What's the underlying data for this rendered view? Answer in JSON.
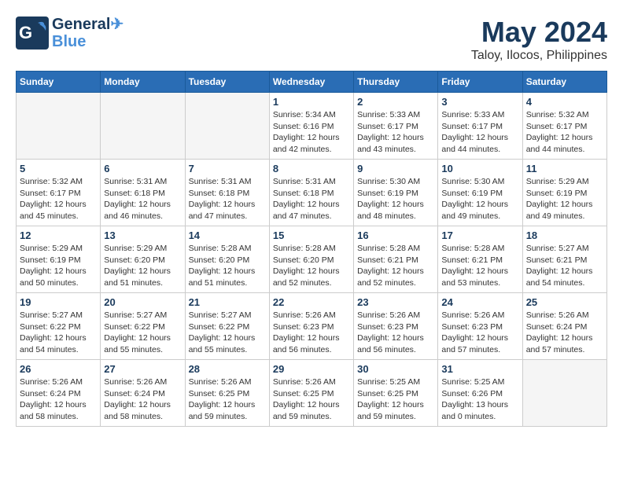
{
  "header": {
    "logo_line1": "General",
    "logo_line2": "Blue",
    "month_year": "May 2024",
    "location": "Taloy, Ilocos, Philippines"
  },
  "weekdays": [
    "Sunday",
    "Monday",
    "Tuesday",
    "Wednesday",
    "Thursday",
    "Friday",
    "Saturday"
  ],
  "weeks": [
    [
      {
        "day": "",
        "empty": true
      },
      {
        "day": "",
        "empty": true
      },
      {
        "day": "",
        "empty": true
      },
      {
        "day": "1",
        "sunrise": "5:34 AM",
        "sunset": "6:16 PM",
        "daylight": "12 hours and 42 minutes."
      },
      {
        "day": "2",
        "sunrise": "5:33 AM",
        "sunset": "6:17 PM",
        "daylight": "12 hours and 43 minutes."
      },
      {
        "day": "3",
        "sunrise": "5:33 AM",
        "sunset": "6:17 PM",
        "daylight": "12 hours and 44 minutes."
      },
      {
        "day": "4",
        "sunrise": "5:32 AM",
        "sunset": "6:17 PM",
        "daylight": "12 hours and 44 minutes."
      }
    ],
    [
      {
        "day": "5",
        "sunrise": "5:32 AM",
        "sunset": "6:17 PM",
        "daylight": "12 hours and 45 minutes."
      },
      {
        "day": "6",
        "sunrise": "5:31 AM",
        "sunset": "6:18 PM",
        "daylight": "12 hours and 46 minutes."
      },
      {
        "day": "7",
        "sunrise": "5:31 AM",
        "sunset": "6:18 PM",
        "daylight": "12 hours and 47 minutes."
      },
      {
        "day": "8",
        "sunrise": "5:31 AM",
        "sunset": "6:18 PM",
        "daylight": "12 hours and 47 minutes."
      },
      {
        "day": "9",
        "sunrise": "5:30 AM",
        "sunset": "6:19 PM",
        "daylight": "12 hours and 48 minutes."
      },
      {
        "day": "10",
        "sunrise": "5:30 AM",
        "sunset": "6:19 PM",
        "daylight": "12 hours and 49 minutes."
      },
      {
        "day": "11",
        "sunrise": "5:29 AM",
        "sunset": "6:19 PM",
        "daylight": "12 hours and 49 minutes."
      }
    ],
    [
      {
        "day": "12",
        "sunrise": "5:29 AM",
        "sunset": "6:19 PM",
        "daylight": "12 hours and 50 minutes."
      },
      {
        "day": "13",
        "sunrise": "5:29 AM",
        "sunset": "6:20 PM",
        "daylight": "12 hours and 51 minutes."
      },
      {
        "day": "14",
        "sunrise": "5:28 AM",
        "sunset": "6:20 PM",
        "daylight": "12 hours and 51 minutes."
      },
      {
        "day": "15",
        "sunrise": "5:28 AM",
        "sunset": "6:20 PM",
        "daylight": "12 hours and 52 minutes."
      },
      {
        "day": "16",
        "sunrise": "5:28 AM",
        "sunset": "6:21 PM",
        "daylight": "12 hours and 52 minutes."
      },
      {
        "day": "17",
        "sunrise": "5:28 AM",
        "sunset": "6:21 PM",
        "daylight": "12 hours and 53 minutes."
      },
      {
        "day": "18",
        "sunrise": "5:27 AM",
        "sunset": "6:21 PM",
        "daylight": "12 hours and 54 minutes."
      }
    ],
    [
      {
        "day": "19",
        "sunrise": "5:27 AM",
        "sunset": "6:22 PM",
        "daylight": "12 hours and 54 minutes."
      },
      {
        "day": "20",
        "sunrise": "5:27 AM",
        "sunset": "6:22 PM",
        "daylight": "12 hours and 55 minutes."
      },
      {
        "day": "21",
        "sunrise": "5:27 AM",
        "sunset": "6:22 PM",
        "daylight": "12 hours and 55 minutes."
      },
      {
        "day": "22",
        "sunrise": "5:26 AM",
        "sunset": "6:23 PM",
        "daylight": "12 hours and 56 minutes."
      },
      {
        "day": "23",
        "sunrise": "5:26 AM",
        "sunset": "6:23 PM",
        "daylight": "12 hours and 56 minutes."
      },
      {
        "day": "24",
        "sunrise": "5:26 AM",
        "sunset": "6:23 PM",
        "daylight": "12 hours and 57 minutes."
      },
      {
        "day": "25",
        "sunrise": "5:26 AM",
        "sunset": "6:24 PM",
        "daylight": "12 hours and 57 minutes."
      }
    ],
    [
      {
        "day": "26",
        "sunrise": "5:26 AM",
        "sunset": "6:24 PM",
        "daylight": "12 hours and 58 minutes."
      },
      {
        "day": "27",
        "sunrise": "5:26 AM",
        "sunset": "6:24 PM",
        "daylight": "12 hours and 58 minutes."
      },
      {
        "day": "28",
        "sunrise": "5:26 AM",
        "sunset": "6:25 PM",
        "daylight": "12 hours and 59 minutes."
      },
      {
        "day": "29",
        "sunrise": "5:26 AM",
        "sunset": "6:25 PM",
        "daylight": "12 hours and 59 minutes."
      },
      {
        "day": "30",
        "sunrise": "5:25 AM",
        "sunset": "6:25 PM",
        "daylight": "12 hours and 59 minutes."
      },
      {
        "day": "31",
        "sunrise": "5:25 AM",
        "sunset": "6:26 PM",
        "daylight": "13 hours and 0 minutes."
      },
      {
        "day": "",
        "empty": true
      }
    ]
  ]
}
